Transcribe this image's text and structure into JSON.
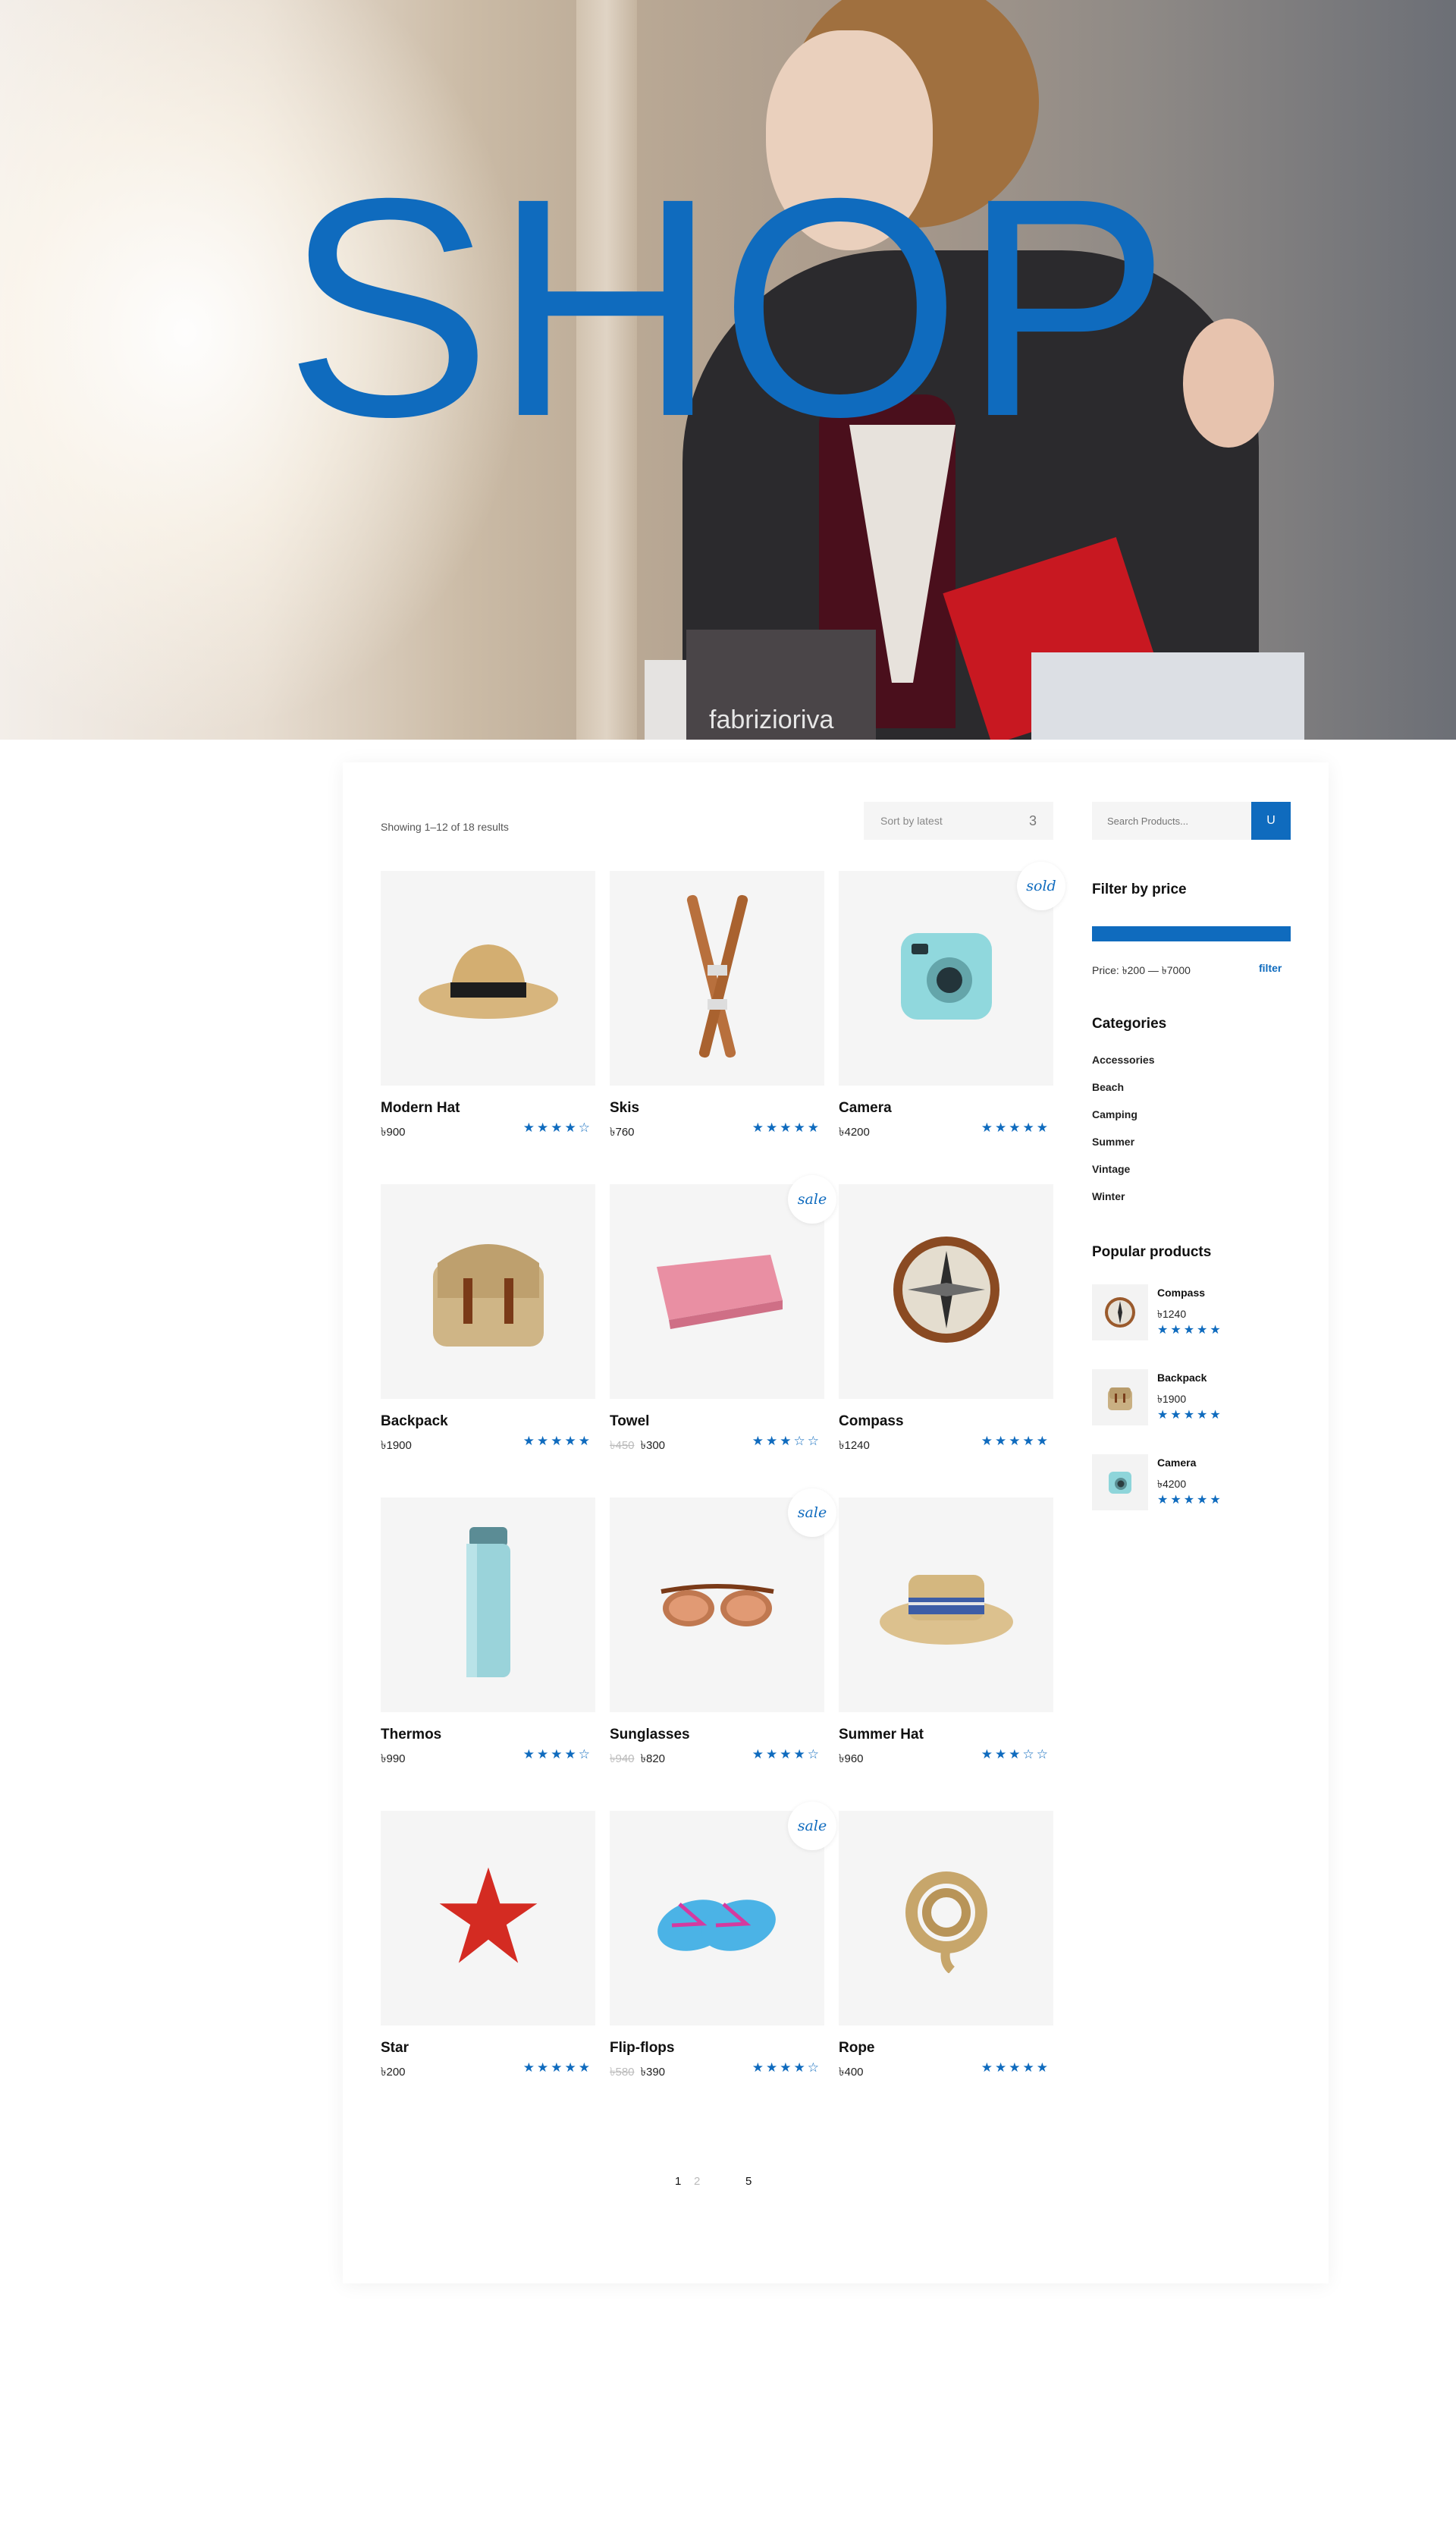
{
  "hero": {
    "title": "SHOP",
    "bag_text": "fabrizioriva"
  },
  "toolbar": {
    "results_text": "Showing 1–12 of 18 results",
    "sort_label": "Sort by latest",
    "sort_caret": "3"
  },
  "sidebar": {
    "search_placeholder": "Search Products...",
    "search_button_label": "U",
    "filter_title": "Filter by price",
    "price_range": "Price: ৳200 — ৳7000",
    "filter_link": "filter",
    "categories_title": "Categories",
    "categories": [
      "Accessories",
      "Beach",
      "Camping",
      "Summer",
      "Vintage",
      "Winter"
    ],
    "popular_title": "Popular products",
    "popular": [
      {
        "name": "Compass",
        "price": "৳1240",
        "stars": "★★★★★",
        "icon": "compass-icon"
      },
      {
        "name": "Backpack",
        "price": "৳1900",
        "stars": "★★★★★",
        "icon": "backpack-icon"
      },
      {
        "name": "Camera",
        "price": "৳4200",
        "stars": "★★★★★",
        "icon": "camera-icon"
      }
    ]
  },
  "products": [
    {
      "name": "Modern Hat",
      "price": "৳900",
      "old_price": "",
      "stars": "★★★★☆",
      "rating": 4,
      "badge": "",
      "icon": "hat-icon"
    },
    {
      "name": "Skis",
      "price": "৳760",
      "old_price": "",
      "stars": "★★★★★",
      "rating": 5,
      "badge": "",
      "icon": "skis-icon"
    },
    {
      "name": "Camera",
      "price": "৳4200",
      "old_price": "",
      "stars": "★★★★★",
      "rating": 5,
      "badge": "sold",
      "icon": "camera-icon"
    },
    {
      "name": "Backpack",
      "price": "৳1900",
      "old_price": "",
      "stars": "★★★★★",
      "rating": 5,
      "badge": "",
      "icon": "backpack-icon"
    },
    {
      "name": "Towel",
      "price": "৳300",
      "old_price": "৳450",
      "stars": "★★★☆☆",
      "rating": 3,
      "badge": "sale",
      "icon": "towel-icon"
    },
    {
      "name": "Compass",
      "price": "৳1240",
      "old_price": "",
      "stars": "★★★★★",
      "rating": 5,
      "badge": "",
      "icon": "compass-icon"
    },
    {
      "name": "Thermos",
      "price": "৳990",
      "old_price": "",
      "stars": "★★★★☆",
      "rating": 4,
      "badge": "",
      "icon": "thermos-icon"
    },
    {
      "name": "Sunglasses",
      "price": "৳820",
      "old_price": "৳940",
      "stars": "★★★★☆",
      "rating": 4,
      "badge": "sale",
      "icon": "sunglasses-icon"
    },
    {
      "name": "Summer Hat",
      "price": "৳960",
      "old_price": "",
      "stars": "★★★☆☆",
      "rating": 3,
      "badge": "",
      "icon": "summer-hat-icon"
    },
    {
      "name": "Star",
      "price": "৳200",
      "old_price": "",
      "stars": "★★★★★",
      "rating": 5,
      "badge": "",
      "icon": "starfish-icon"
    },
    {
      "name": "Flip-flops",
      "price": "৳390",
      "old_price": "৳580",
      "stars": "★★★★☆",
      "rating": 4,
      "badge": "sale",
      "icon": "flip-flops-icon"
    },
    {
      "name": "Rope",
      "price": "৳400",
      "old_price": "",
      "stars": "★★★★★",
      "rating": 5,
      "badge": "",
      "icon": "rope-icon"
    }
  ],
  "pagination": {
    "pages": [
      "1",
      "2",
      "5"
    ],
    "current": "1"
  },
  "colors": {
    "accent": "#0f6bbe",
    "thumb_bg": "#f5f5f5"
  }
}
